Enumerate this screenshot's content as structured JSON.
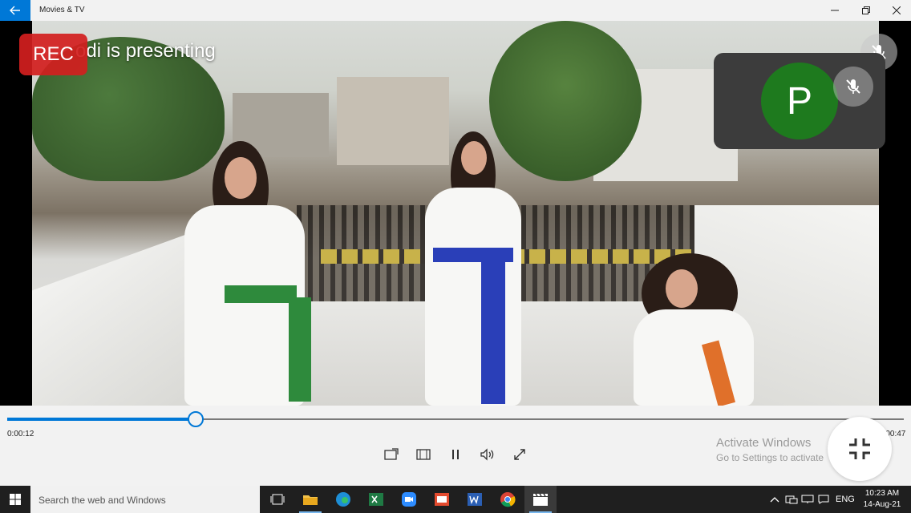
{
  "app": {
    "title": "Movies & TV"
  },
  "meeting": {
    "presenting_text": "odi is presenting",
    "rec_label": "REC",
    "participant_initial": "P",
    "avatar_color": "#1e7a1e"
  },
  "player": {
    "elapsed": "0:00:12",
    "total": "0:00:47",
    "progress_fraction": 0.21
  },
  "watermark": {
    "line1": "Activate Windows",
    "line2": "Go to Settings to activate"
  },
  "taskbar": {
    "search_placeholder": "Search the web and Windows",
    "language": "ENG",
    "time": "10:23 AM",
    "date": "14-Aug-21"
  },
  "icons": {
    "back": "back-arrow-icon",
    "minimize": "minimize-icon",
    "restore": "restore-icon",
    "close": "close-icon",
    "mic_off": "mic-off-icon",
    "cast": "cast-icon",
    "aspect": "aspect-ratio-icon",
    "pause": "pause-icon",
    "volume": "volume-icon",
    "fullscreen": "fullscreen-icon",
    "exit_fullscreen": "exit-fullscreen-icon"
  },
  "colors": {
    "accent": "#0078d7",
    "rec": "#d21e1e"
  }
}
